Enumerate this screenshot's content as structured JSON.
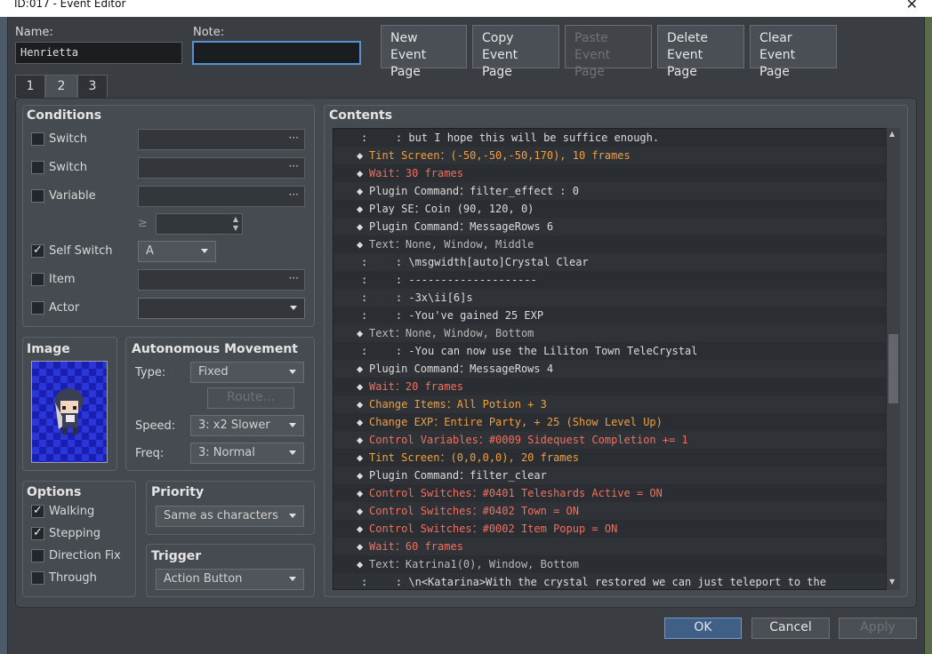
{
  "window": {
    "title": "ID:017 - Event Editor",
    "close_glyph": "✕"
  },
  "name_label": "Name:",
  "name_value": "Henrietta",
  "note_label": "Note:",
  "note_value": "",
  "buttons": {
    "new": [
      "New",
      "Event Page"
    ],
    "copy": [
      "Copy",
      "Event Page"
    ],
    "paste": [
      "Paste",
      "Event Page"
    ],
    "delete": [
      "Delete",
      "Event Page"
    ],
    "clear": [
      "Clear",
      "Event Page"
    ]
  },
  "tabs": [
    "1",
    "2",
    "3"
  ],
  "active_tab": "2",
  "conditions": {
    "title": "Conditions",
    "rows": [
      {
        "label": "Switch",
        "checked": false,
        "value": "",
        "kind": "dots"
      },
      {
        "label": "Switch",
        "checked": false,
        "value": "",
        "kind": "dots"
      },
      {
        "label": "Variable",
        "checked": false,
        "value": "",
        "kind": "dots"
      },
      {
        "label": "Self Switch",
        "checked": true,
        "value": "A",
        "kind": "combo"
      },
      {
        "label": "Item",
        "checked": false,
        "value": "",
        "kind": "dots"
      },
      {
        "label": "Actor",
        "checked": false,
        "value": "",
        "kind": "combo"
      }
    ],
    "ge": "≥",
    "dots": "···"
  },
  "image": {
    "title": "Image"
  },
  "movement": {
    "title": "Autonomous Movement",
    "type_label": "Type:",
    "type_value": "Fixed",
    "route_label": "Route...",
    "speed_label": "Speed:",
    "speed_value": "3: x2 Slower",
    "freq_label": "Freq:",
    "freq_value": "3: Normal"
  },
  "options": {
    "title": "Options",
    "items": [
      {
        "label": "Walking",
        "checked": true
      },
      {
        "label": "Stepping",
        "checked": true
      },
      {
        "label": "Direction Fix",
        "checked": false
      },
      {
        "label": "Through",
        "checked": false
      }
    ]
  },
  "priority": {
    "title": "Priority",
    "value": "Same as characters"
  },
  "trigger": {
    "title": "Trigger",
    "value": "Action Button"
  },
  "contents": {
    "title": "Contents",
    "rows": [
      {
        "mark": ":",
        "text": "    : but I hope this will be suffice enough.",
        "color": "white"
      },
      {
        "mark": "◆",
        "text": "Tint Screen：(-50,-50,-50,170), 10 frames",
        "color": "orange"
      },
      {
        "mark": "◆",
        "text": "Wait：30 frames",
        "color": "red"
      },
      {
        "mark": "◆",
        "text": "Plugin Command：filter_effect : 0",
        "color": "white"
      },
      {
        "mark": "◆",
        "text": "Play SE：Coin (90, 120, 0)",
        "color": "white"
      },
      {
        "mark": "◆",
        "text": "Plugin Command：MessageRows 6",
        "color": "white"
      },
      {
        "mark": "◆",
        "text": "Text：None, Window, Middle",
        "color": "grey"
      },
      {
        "mark": ":",
        "text": "    : \\msgwidth[auto]Crystal Clear",
        "color": "white"
      },
      {
        "mark": ":",
        "text": "    : --------------------",
        "color": "white"
      },
      {
        "mark": ":",
        "text": "    : -3x\\ii[6]s",
        "color": "white"
      },
      {
        "mark": ":",
        "text": "    : -You've gained 25 EXP",
        "color": "white"
      },
      {
        "mark": "◆",
        "text": "Text：None, Window, Bottom",
        "color": "grey"
      },
      {
        "mark": ":",
        "text": "    : -You can now use the Liliton Town TeleCrystal",
        "color": "white"
      },
      {
        "mark": "◆",
        "text": "Plugin Command：MessageRows 4",
        "color": "white"
      },
      {
        "mark": "◆",
        "text": "Wait：20 frames",
        "color": "red"
      },
      {
        "mark": "◆",
        "text": "Change Items：All Potion + 3",
        "color": "orange"
      },
      {
        "mark": "◆",
        "text": "Change EXP：Entire Party, + 25 (Show Level Up)",
        "color": "orange"
      },
      {
        "mark": "◆",
        "text": "Control Variables：#0009 Sidequest Completion += 1",
        "color": "red"
      },
      {
        "mark": "◆",
        "text": "Tint Screen：(0,0,0,0), 20 frames",
        "color": "orange"
      },
      {
        "mark": "◆",
        "text": "Plugin Command：filter_clear",
        "color": "white"
      },
      {
        "mark": "◆",
        "text": "Control Switches：#0401 Teleshards Active = ON",
        "color": "red"
      },
      {
        "mark": "◆",
        "text": "Control Switches：#0402 Town = ON",
        "color": "red"
      },
      {
        "mark": "◆",
        "text": "Control Switches：#0002 Item Popup = ON",
        "color": "red"
      },
      {
        "mark": "◆",
        "text": "Wait：60 frames",
        "color": "red"
      },
      {
        "mark": "◆",
        "text": "Text：Katrina1(0), Window, Bottom",
        "color": "grey"
      },
      {
        "mark": ":",
        "text": "    : \\n<Katarina>With the crystal restored we can just teleport to the",
        "color": "white"
      }
    ]
  },
  "footer": {
    "ok": "OK",
    "cancel": "Cancel",
    "apply": "Apply"
  },
  "colors": {
    "accent": "#5a8fd6",
    "red": "#f07060",
    "orange": "#f0a040"
  }
}
